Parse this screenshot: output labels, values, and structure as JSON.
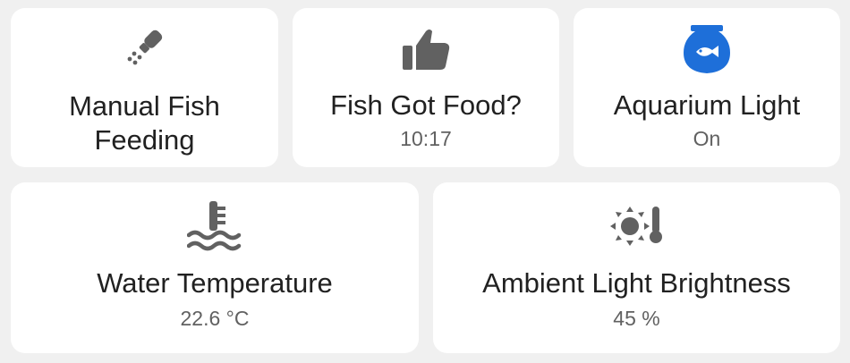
{
  "colors": {
    "background": "#f0f0f0",
    "card": "#ffffff",
    "icon_default": "#616161",
    "icon_active": "#1e6fd9",
    "title_text": "#212121",
    "state_text": "#616161"
  },
  "cards": [
    {
      "icon": "salt-shaker-icon",
      "title": "Manual Fish\nFeeding"
    },
    {
      "icon": "thumb-up-icon",
      "title": "Fish Got Food?",
      "state": "10:17"
    },
    {
      "icon": "fishbowl-icon",
      "title": "Aquarium Light",
      "state": "On"
    },
    {
      "icon": "water-thermometer-icon",
      "title": "Water Temperature",
      "state": "22.6 °C"
    },
    {
      "icon": "sun-thermometer-icon",
      "title": "Ambient Light Brightness",
      "state": "45 %"
    }
  ]
}
